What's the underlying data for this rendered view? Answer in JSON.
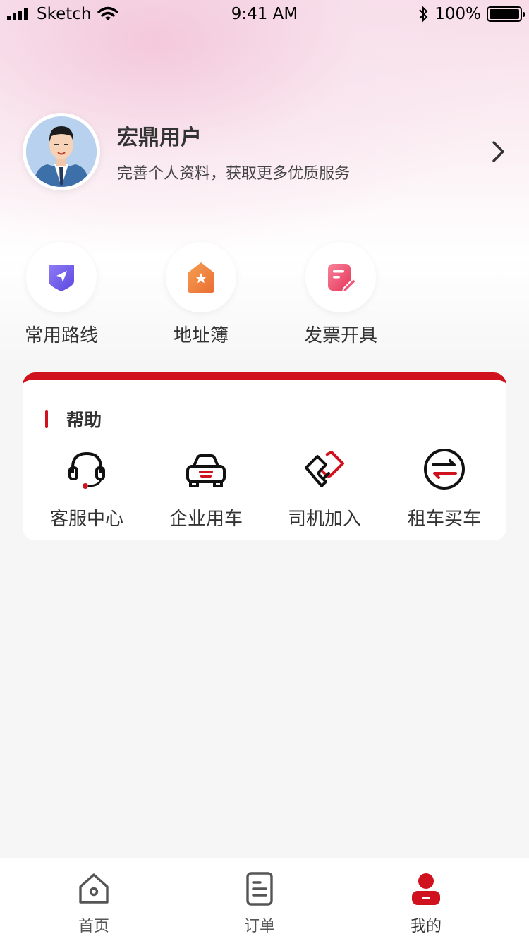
{
  "status_bar": {
    "carrier": "Sketch",
    "time": "9:41 AM",
    "battery": "100%"
  },
  "profile": {
    "name": "宏鼎用户",
    "subtitle": "完善个人资料，获取更多优质服务"
  },
  "quick_actions": [
    {
      "label": "常用路线",
      "icon": "route-icon"
    },
    {
      "label": "地址簿",
      "icon": "address-book-icon"
    },
    {
      "label": "发票开具",
      "icon": "invoice-icon"
    }
  ],
  "help": {
    "title": "帮助",
    "items": [
      {
        "label": "客服中心",
        "icon": "headset-icon"
      },
      {
        "label": "企业用车",
        "icon": "car-icon"
      },
      {
        "label": "司机加入",
        "icon": "handshake-icon"
      },
      {
        "label": "租车买车",
        "icon": "exchange-icon"
      }
    ]
  },
  "tabbar": {
    "items": [
      {
        "label": "首页",
        "icon": "home-icon"
      },
      {
        "label": "订单",
        "icon": "order-icon"
      },
      {
        "label": "我的",
        "icon": "user-icon",
        "active": true
      }
    ]
  },
  "colors": {
    "brand_red": "#d0121f",
    "background": "#f6f6f6",
    "text": "#333333"
  }
}
